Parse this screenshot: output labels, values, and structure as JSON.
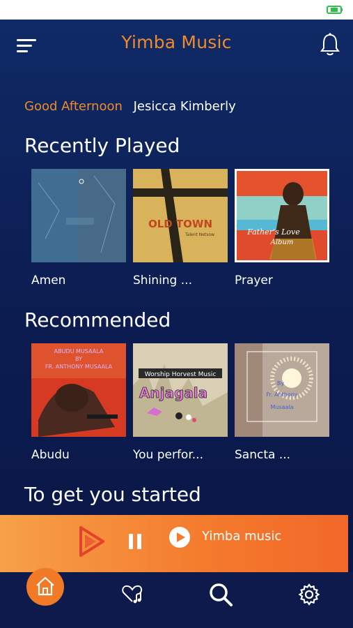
{
  "app": {
    "title": "Yimba Music"
  },
  "greeting": {
    "time_of_day": "Good Afternoon",
    "user_name": "Jesicca Kimberly"
  },
  "sections": {
    "recently_played": {
      "title": "Recently Played",
      "items": [
        {
          "label": "Amen",
          "cover": "blue-grunge-cover"
        },
        {
          "label": "Shining ...",
          "cover": "old-town-cover"
        },
        {
          "label": "Prayer",
          "cover": "fathers-love-album-cover"
        }
      ]
    },
    "recommended": {
      "title": "Recommended",
      "items": [
        {
          "label": "Abudu",
          "cover": "abudu-cover"
        },
        {
          "label": "You perfor...",
          "cover": "anjagala-cover"
        },
        {
          "label": "Sancta ...",
          "cover": "sancta-cover"
        }
      ]
    },
    "get_started": {
      "title": "To get you started"
    }
  },
  "covers_text": {
    "old_town": "OLD TOWN",
    "old_town_sub": "Talent Netsow",
    "fathers_love": "Father's Love",
    "fathers_love_sub": "Album",
    "abudu_title": "ABUDU MUSAALA",
    "abudu_by": "BY",
    "abudu_artist": "FR. ANTHONY MUSAALA",
    "anjagala_band": "Worship Horvest Music",
    "anjagala_title": "Anjagala",
    "sancta_by": "By",
    "sancta_artist": "Fr. Anthony",
    "sancta_artist2": "Musaala"
  },
  "player": {
    "title": "Yimba music"
  },
  "colors": {
    "accent": "#f18a2a",
    "background": "#0c1d52",
    "player_start": "#f6a049",
    "player_end": "#f2672a"
  },
  "icons": {
    "menu": "hamburger-icon",
    "notifications": "bell-icon",
    "pause": "pause-icon",
    "play": "play-icon",
    "home": "home-icon",
    "favorites": "heart-music-icon",
    "search": "search-icon",
    "settings": "gear-icon"
  }
}
